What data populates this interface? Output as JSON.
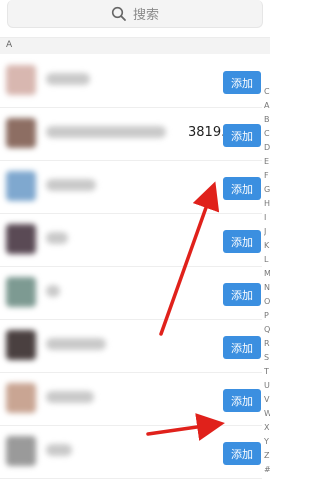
{
  "search": {
    "placeholder": "搜索"
  },
  "section": {
    "letter": "A"
  },
  "contacts": [
    {
      "add_label": "添加",
      "phone_fragment": ""
    },
    {
      "add_label": "添加",
      "phone_fragment": "3819.."
    },
    {
      "add_label": "添加",
      "phone_fragment": ""
    },
    {
      "add_label": "添加",
      "phone_fragment": ""
    },
    {
      "add_label": "添加",
      "phone_fragment": ""
    },
    {
      "add_label": "添加",
      "phone_fragment": ""
    },
    {
      "add_label": "添加",
      "phone_fragment": ""
    },
    {
      "add_label": "添加",
      "phone_fragment": ""
    }
  ],
  "index_letters": [
    "C",
    "A",
    "B",
    "C",
    "D",
    "E",
    "F",
    "G",
    "H",
    "I",
    "J",
    "K",
    "L",
    "M",
    "N",
    "O",
    "P",
    "Q",
    "R",
    "S",
    "T",
    "U",
    "V",
    "W",
    "X",
    "Y",
    "Z",
    "#"
  ],
  "colors": {
    "accent": "#3b8fe0",
    "annotation_arrow": "#e0211b"
  },
  "icons": {
    "search": "search-icon",
    "annotation": "red-arrow-icon"
  }
}
